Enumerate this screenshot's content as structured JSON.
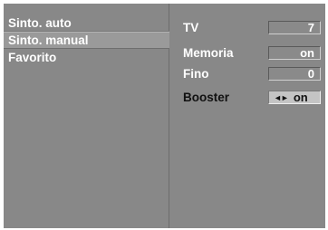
{
  "menu": {
    "items": [
      {
        "label": "Sinto. auto"
      },
      {
        "label": "Sinto. manual"
      },
      {
        "label": "Favorito"
      }
    ]
  },
  "params": {
    "tv": {
      "label": "TV",
      "value": "7"
    },
    "memoria": {
      "label": "Memoria",
      "value": "on"
    },
    "fino": {
      "label": "Fino",
      "value": "0"
    },
    "booster": {
      "label": "Booster",
      "arrows": "◄►",
      "value": "on"
    }
  },
  "colors": {
    "background": "#888888",
    "selected_item": "#9a9a9a",
    "active_box": "#c4c4c4",
    "text": "#ffffff",
    "active_text": "#111111"
  }
}
